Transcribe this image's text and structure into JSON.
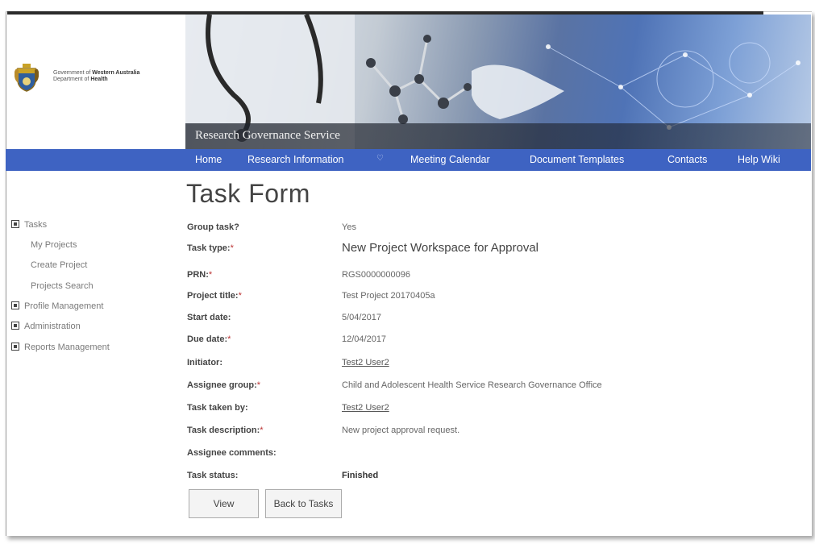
{
  "header": {
    "gov_line1_pre": "Government of ",
    "gov_line1_bold": "Western Australia",
    "gov_line2_pre": "Department of ",
    "gov_line2_bold": "Health",
    "banner_title": "Research Governance Service"
  },
  "nav": {
    "items": [
      {
        "label": "Home"
      },
      {
        "label": "Research Information",
        "icon": "chevron-down-icon"
      },
      {
        "label": "Meeting Calendar"
      },
      {
        "label": "Document Templates"
      },
      {
        "label": "Contacts"
      },
      {
        "label": "Help Wiki"
      }
    ]
  },
  "sidebar": {
    "items": [
      {
        "label": "Tasks",
        "expandable": true
      },
      {
        "label": "My Projects",
        "expandable": false
      },
      {
        "label": "Create Project",
        "expandable": false
      },
      {
        "label": "Projects Search",
        "expandable": false
      },
      {
        "label": "Profile Management",
        "expandable": true
      },
      {
        "label": "Administration",
        "expandable": true
      },
      {
        "label": "Reports Management",
        "expandable": true
      }
    ]
  },
  "form": {
    "title": "Task Form",
    "required_marker": "*",
    "fields": [
      {
        "label": "Group task?",
        "required": false,
        "value": "Yes"
      },
      {
        "label": "Task type:",
        "required": true,
        "value": "New Project Workspace for Approval"
      },
      {
        "label": "PRN:",
        "required": true,
        "value": "RGS0000000096"
      },
      {
        "label": "Project title:",
        "required": true,
        "value": "Test Project 20170405a"
      },
      {
        "label": "Start date:",
        "required": false,
        "value": "5/04/2017"
      },
      {
        "label": "Due date:",
        "required": true,
        "value": "12/04/2017"
      },
      {
        "label": "Initiator:",
        "required": false,
        "value": "Test2 User2"
      },
      {
        "label": "Assignee group:",
        "required": true,
        "value": "Child and Adolescent Health Service Research Governance Office"
      },
      {
        "label": "Task taken by:",
        "required": false,
        "value": "Test2 User2"
      },
      {
        "label": "Task description:",
        "required": true,
        "value": "New project approval request."
      },
      {
        "label": "Assignee comments:",
        "required": false,
        "value": ""
      },
      {
        "label": "Task status:",
        "required": false,
        "value": "Finished"
      }
    ]
  },
  "buttons": {
    "view": "View",
    "back": "Back to Tasks"
  },
  "colors": {
    "nav_bar": "#3e63c2",
    "banner_accent": "#4f73b6"
  }
}
